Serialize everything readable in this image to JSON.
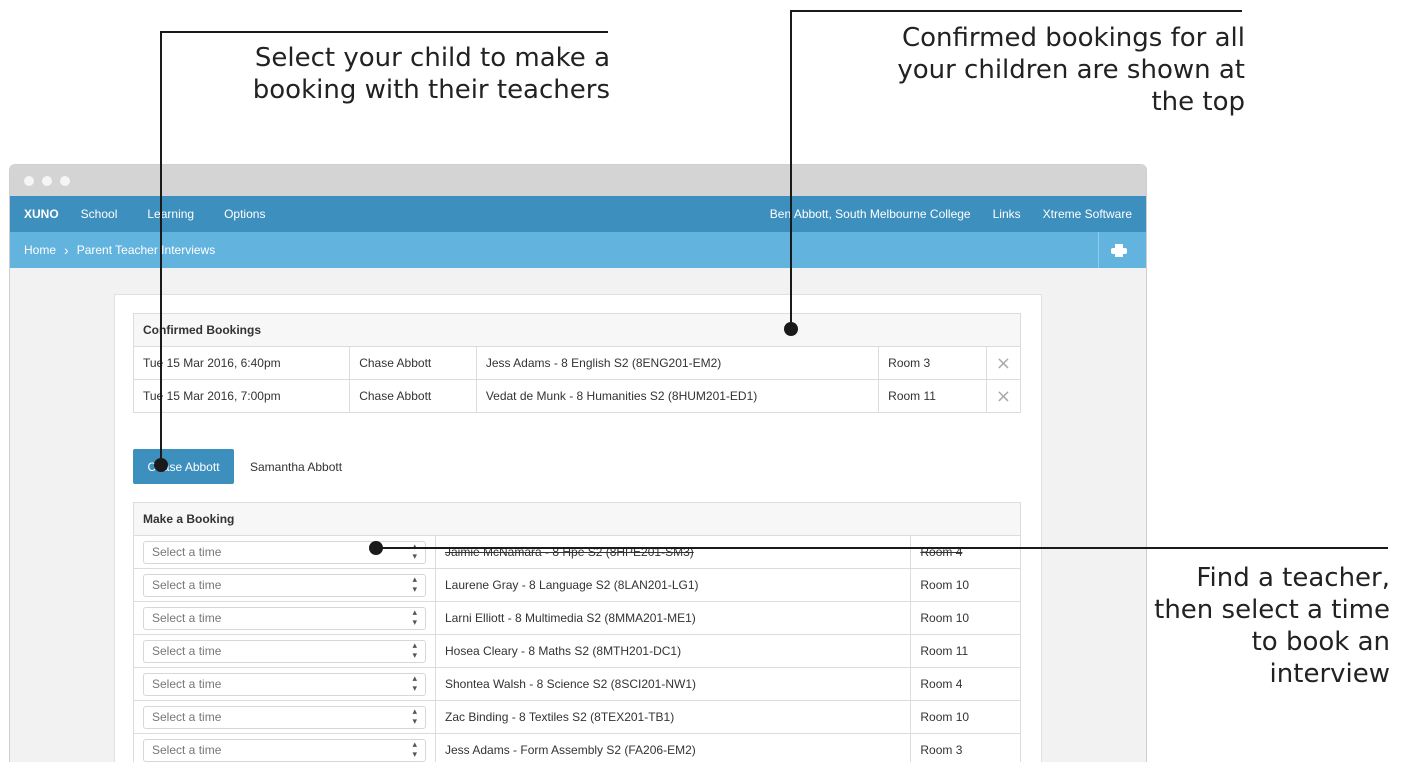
{
  "annotations": {
    "child_select": "Select your child to make a booking with their teachers",
    "confirmed_info": "Confirmed bookings for all your children are shown at the top",
    "find_teacher": "Find a teacher, then select a time to book an interview"
  },
  "navbar": {
    "brand": "XUNO",
    "items": [
      "School",
      "Learning",
      "Options"
    ],
    "right_items": [
      "Ben Abbott, South Melbourne College",
      "Links",
      "Xtreme Software"
    ]
  },
  "breadcrumb": {
    "home": "Home",
    "current": "Parent Teacher Interviews"
  },
  "confirmed": {
    "title": "Confirmed Bookings",
    "rows": [
      {
        "time": "Tue 15 Mar 2016, 6:40pm",
        "child": "Chase Abbott",
        "teacher": "Jess Adams - 8 English S2 (8ENG201-EM2)",
        "room": "Room 3",
        "remove": "×"
      },
      {
        "time": "Tue 15 Mar 2016, 7:00pm",
        "child": "Chase Abbott",
        "teacher": "Vedat de Munk - 8 Humanities S2 (8HUM201-ED1)",
        "room": "Room 11",
        "remove": "×"
      }
    ]
  },
  "children": {
    "active": "Chase Abbott",
    "other": "Samantha Abbott"
  },
  "booking": {
    "title": "Make a Booking",
    "placeholder": "Select a time",
    "rows": [
      {
        "teacher": "Jaimie McNamara - 8 Hpe S2 (8HPE201-SM3)",
        "room": "Room 4"
      },
      {
        "teacher": "Laurene Gray - 8 Language S2 (8LAN201-LG1)",
        "room": "Room 10"
      },
      {
        "teacher": "Larni Elliott - 8 Multimedia S2 (8MMA201-ME1)",
        "room": "Room 10"
      },
      {
        "teacher": "Hosea Cleary - 8 Maths S2 (8MTH201-DC1)",
        "room": "Room 11"
      },
      {
        "teacher": "Shontea Walsh - 8 Science S2 (8SCI201-NW1)",
        "room": "Room 4"
      },
      {
        "teacher": "Zac Binding - 8 Textiles S2 (8TEX201-TB1)",
        "room": "Room 10"
      },
      {
        "teacher": "Jess Adams - Form Assembly S2 (FA206-EM2)",
        "room": "Room 3"
      }
    ]
  },
  "colors": {
    "navbar": "#3d8fbe",
    "breadcrumb_bar": "#63b3df",
    "active_tab": "#3d8fbe"
  }
}
